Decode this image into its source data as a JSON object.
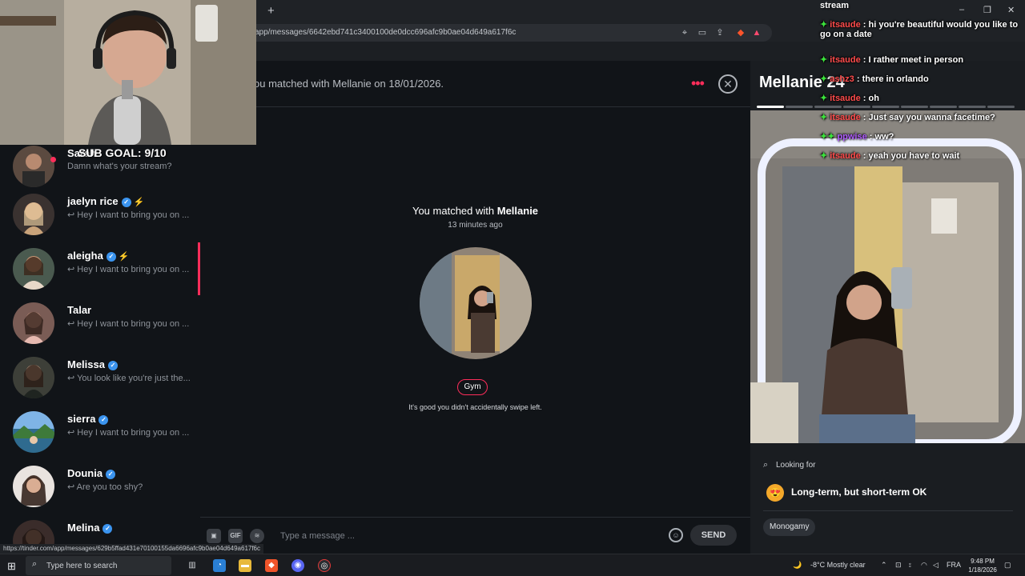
{
  "browser": {
    "url": "tinder.com/app/messages/6642ebd741c3400100de0dcc696afc9b0ae04d649a617f6c",
    "url_display": "app/messages/6642ebd741c3400100de0dcc696afc9b0ae04d649a617f6c",
    "new_tab_symbol": "+",
    "status_url": "https://tinder.com/app/messages/629b5ffad431e70100155da6696afc9b0ae04d649a617f6c"
  },
  "stream": {
    "sub_goal": "SUB GOAL: 9/10",
    "chat_header": "stream",
    "chat": [
      {
        "user": "itsaude",
        "text": " : hi you're beautiful would you like to go on a date",
        "purple": false
      },
      {
        "user": "itsaude",
        "text": " : I rather meet in person",
        "purple": false
      },
      {
        "user": "ashz3",
        "text": " : there in orlando",
        "purple": false
      },
      {
        "user": "itsaude",
        "text": " : oh",
        "purple": false
      },
      {
        "user": "itsaude",
        "text": " : Just say you wanna facetime?",
        "purple": false
      },
      {
        "user": "ppwise",
        "text": " : ww?",
        "purple": true
      },
      {
        "user": "itsaude",
        "text": " : yeah you have to wait",
        "purple": false
      }
    ]
  },
  "sidebar": {
    "conversations": [
      {
        "name": "Sarah",
        "preview": "Damn what's your stream?",
        "verified": false,
        "bolt": false
      },
      {
        "name": "jaelyn rice",
        "preview": "↩ Hey I want to bring you on ...",
        "verified": true,
        "bolt": true
      },
      {
        "name": "aleigha",
        "preview": "↩ Hey I want to bring you on ...",
        "verified": true,
        "bolt": true
      },
      {
        "name": "Talar",
        "preview": "↩ Hey I want to bring you on ...",
        "verified": false,
        "bolt": false
      },
      {
        "name": "Melissa",
        "preview": "↩ You look like you're just the...",
        "verified": true,
        "bolt": false
      },
      {
        "name": "sierra",
        "preview": "↩ Hey I want to bring you on ...",
        "verified": true,
        "bolt": false
      },
      {
        "name": "Dounia",
        "preview": "↩ Are you too shy?",
        "verified": true,
        "bolt": false
      },
      {
        "name": "Melina",
        "preview": "",
        "verified": true,
        "bolt": false
      }
    ]
  },
  "chat": {
    "header_text": "ou matched with Mellanie on 18/01/2026.",
    "matched_prefix": "You matched with ",
    "matched_name": "Mellanie",
    "matched_time": "13 minutes ago",
    "interest_chip": "Gym",
    "swipe_note": "It's good you didn't accidentally swipe left.",
    "composer_placeholder": "Type a message ...",
    "send_label": "SEND",
    "gif_label": "GIF"
  },
  "profile": {
    "name_age": "Mellanie 24",
    "photo_count": 9,
    "active_photo": 0,
    "looking_for_label": "Looking for",
    "looking_for_value": "Long-term, but short-term OK",
    "looking_for_emoji": "😍",
    "relationship_type": "Monogamy"
  },
  "taskbar": {
    "search_placeholder": "Type here to search",
    "weather": "-8°C  Mostly clear",
    "language": "FRA",
    "time": "9:48 PM",
    "date": "1/18/2026"
  },
  "colors": {
    "accent": "#fd2d5a",
    "verified": "#3b94ef",
    "background": "#111418"
  }
}
